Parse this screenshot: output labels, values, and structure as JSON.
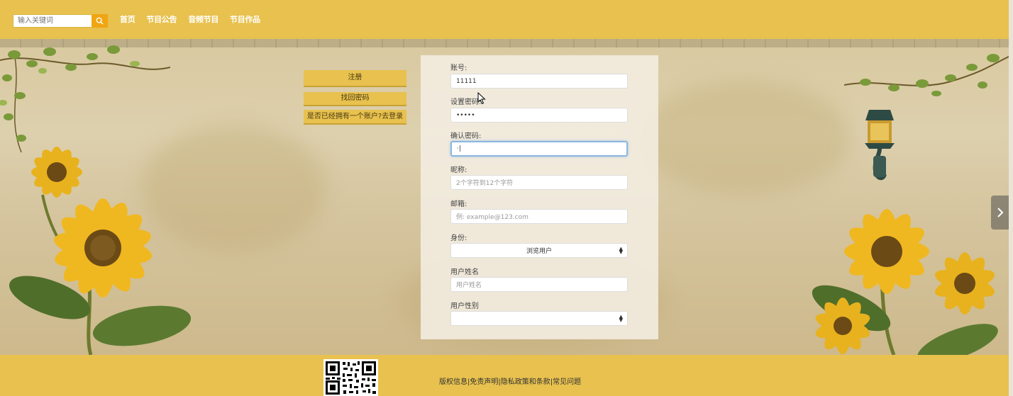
{
  "header": {
    "search": {
      "placeholder": "输入关键词",
      "icon": "search-icon"
    },
    "nav": [
      {
        "label": "首页"
      },
      {
        "label": "节目公告"
      },
      {
        "label": "音频节目"
      },
      {
        "label": "节目作品"
      }
    ]
  },
  "side_buttons": {
    "register": "注册",
    "recover": "找回密码",
    "login_prompt": "是否已经拥有一个账户?去登录"
  },
  "form": {
    "account": {
      "label": "账号:",
      "value": "11111"
    },
    "password": {
      "label": "设置密码:",
      "value": "•••••"
    },
    "confirm_password": {
      "label": "确认密码:",
      "value": "·|"
    },
    "nickname": {
      "label": "昵称:",
      "placeholder": "2个字符到12个字符"
    },
    "email": {
      "label": "邮箱:",
      "placeholder": "例: example@123.com"
    },
    "role": {
      "label": "身份:",
      "selected": "浏览用户"
    },
    "real_name": {
      "label": "用户姓名",
      "placeholder": "用户姓名"
    },
    "gender": {
      "label": "用户性别",
      "selected": ""
    }
  },
  "footer": {
    "links": [
      "版权信息",
      "免责声明",
      "隐私政策和条款",
      "常见问题"
    ],
    "separator": "|"
  },
  "colors": {
    "brand": "#e8c14e",
    "search_button": "#f0a512",
    "focus_border": "#8fb6e0"
  }
}
